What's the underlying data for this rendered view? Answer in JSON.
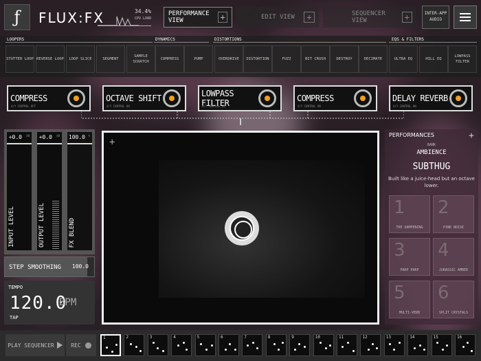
{
  "app": {
    "brand": "FLUX:FX",
    "logo_glyph": "ƒ",
    "cpu_value": "34.4%",
    "cpu_label": "CPU LOAD"
  },
  "views": [
    {
      "label": "PERFORMANCE VIEW",
      "active": true
    },
    {
      "label": "EDIT VIEW",
      "active": false
    },
    {
      "label": "SEQUENCER VIEW",
      "active": false
    }
  ],
  "inter_app": "INTER-APP AUDIO",
  "categories": [
    {
      "label": "LOOPERS"
    },
    {
      "label": "DYNAMICS"
    },
    {
      "label": "DISTORTIONS"
    },
    {
      "label": "EQS & FILTERS"
    }
  ],
  "effects": [
    "STUTTER LOOP",
    "REVERSE LOOP",
    "LOOP SLICE",
    "SEGMENT",
    "SAMPLE SCRATCH",
    "COMPRESS",
    "PUMP",
    "OVERDRIVE",
    "DISTORTION",
    "FUZZ",
    "BIT CRUSH",
    "DESTROY",
    "DECIMATE",
    "ULTRA EQ",
    "HILL EQ",
    "LOWPASS FILTER"
  ],
  "slots": [
    {
      "name": "COMPRESS",
      "sub": "X/Y CONTROL OFF"
    },
    {
      "name": "OCTAVE SHIFT",
      "sub": "X/Y CONTROL ON"
    },
    {
      "name": "LOWPASS FILTER",
      "sub": "X/Y CONTROL ON"
    },
    {
      "name": "COMPRESS",
      "sub": "X/Y CONTROL ON"
    },
    {
      "name": "DELAY REVERB",
      "sub": "X/Y CONTROL ON"
    }
  ],
  "meters": [
    {
      "value": "+0.0",
      "unit": "dB",
      "label": "INPUT LEVEL"
    },
    {
      "value": "+0.0",
      "unit": "dB",
      "label": "OUTPUT LEVEL"
    },
    {
      "value": "100.0",
      "unit": "%",
      "label": "FX BLEND"
    }
  ],
  "step_smoothing": {
    "label": "STEP SMOOTHING",
    "value": "100.0"
  },
  "tempo": {
    "label": "TEMPO",
    "value": "120.0",
    "unit": "BPM",
    "tap": "TAP"
  },
  "performances": {
    "title": "PERFORMANCES",
    "bank_label": "BANK",
    "bank": "AMBIENCE",
    "name": "SUBTHUG",
    "description": "Built like a juice-head but an octave lower.",
    "items": [
      {
        "num": "1",
        "name": "THE DAMPENING"
      },
      {
        "num": "2",
        "name": "PINK NOISE"
      },
      {
        "num": "3",
        "name": "PARP PARP"
      },
      {
        "num": "4",
        "name": "JURASSIC AMBER"
      },
      {
        "num": "5",
        "name": "MULTI-VERB"
      },
      {
        "num": "6",
        "name": "SPLIT CRYSTALS"
      }
    ]
  },
  "sequencer": {
    "play_label": "PLAY SEQUENCER",
    "rec_label": "REC",
    "steps": [
      "1",
      "2",
      "3",
      "4",
      "5",
      "6",
      "7",
      "8",
      "9",
      "10",
      "11",
      "12",
      "13",
      "14",
      "15",
      "16"
    ],
    "selected": 1
  }
}
